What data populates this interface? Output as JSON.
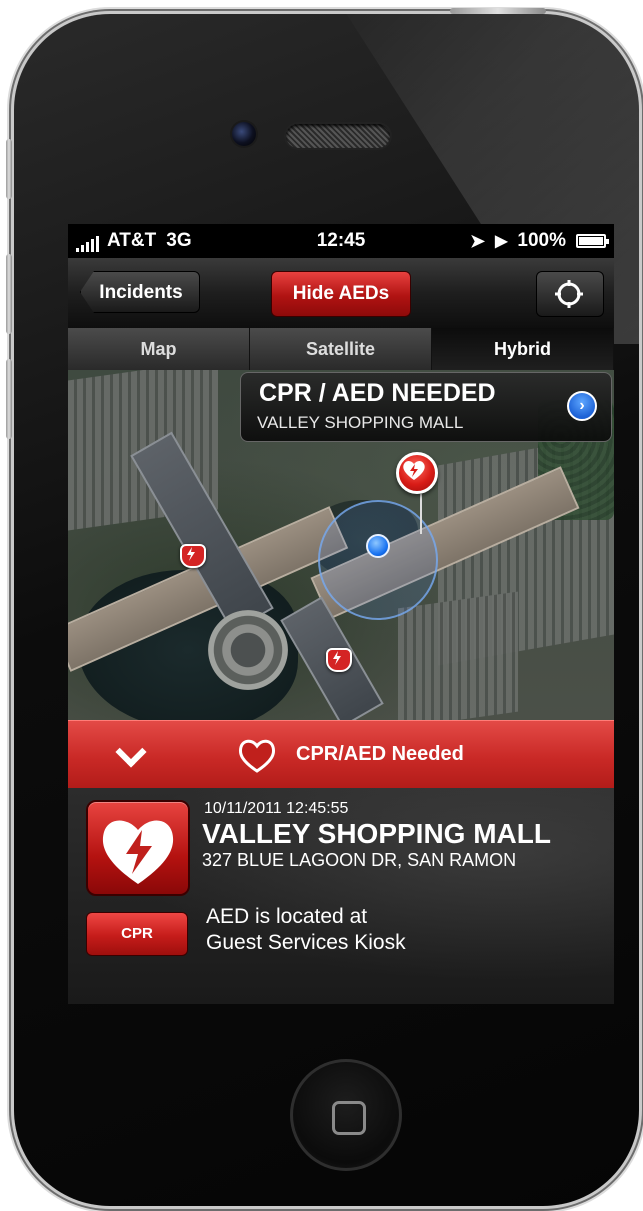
{
  "status_bar": {
    "carrier": "AT&T",
    "network": "3G",
    "time": "12:45",
    "battery": "100%"
  },
  "nav_bar": {
    "back_label": "Incidents",
    "toggle_label": "Hide AEDs",
    "locate_icon": "crosshair-icon"
  },
  "segments": {
    "items": [
      "Map",
      "Satellite",
      "Hybrid"
    ],
    "selected": "Hybrid"
  },
  "callout": {
    "title": "CPR / AED NEEDED",
    "subtitle": "VALLEY SHOPPING MALL"
  },
  "alert_bar": {
    "label": "CPR/AED Needed"
  },
  "incident": {
    "datetime": "10/11/2011 12:45:55",
    "place": "VALLEY SHOPPING MALL",
    "address": "327 BLUE LAGOON DR, SAN RAMON",
    "cpr_label": "CPR",
    "aed_location_line1": "AED is located at",
    "aed_location_line2": "Guest Services Kiosk"
  },
  "colors": {
    "accent_red": "#c92926",
    "disclosure_blue": "#1d62d6"
  }
}
